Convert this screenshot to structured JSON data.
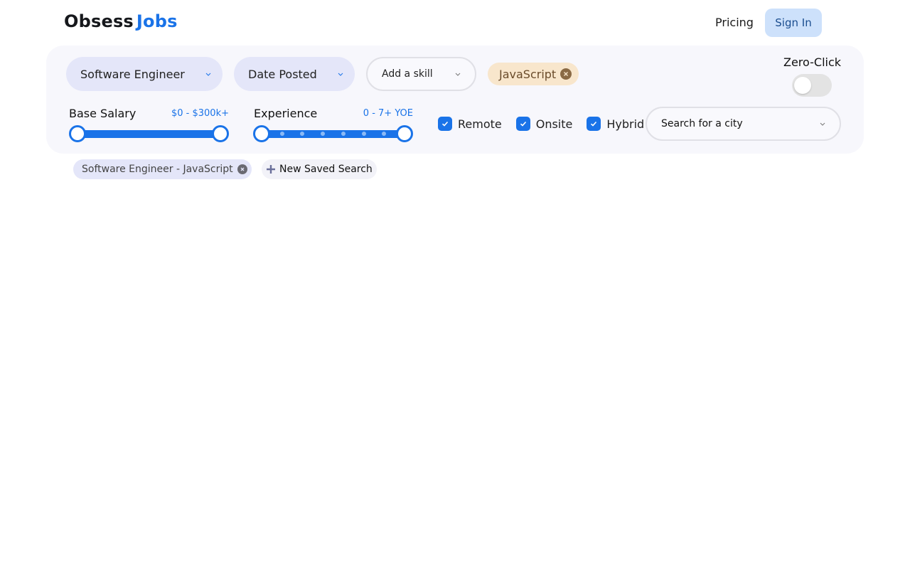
{
  "header": {
    "logo_part1": "Obsess",
    "logo_part2": "Jobs",
    "pricing_label": "Pricing",
    "signin_label": "Sign In"
  },
  "filters": {
    "role_select": {
      "value": "Software Engineer",
      "icon": "chevron-down-icon"
    },
    "date_select": {
      "value": "Date Posted",
      "icon": "chevron-down-icon"
    },
    "skill_select": {
      "placeholder": "Add a skill",
      "icon": "chevron-down-icon"
    },
    "selected_skills": [
      {
        "label": "JavaScript",
        "remove_icon": "close-circle-icon"
      }
    ],
    "zero_click": {
      "label": "Zero-Click",
      "enabled": false
    },
    "base_salary": {
      "label": "Base Salary",
      "range_text": "$0 - $300k+",
      "min": 0,
      "max": 300,
      "unit": "k",
      "selected_min": 0,
      "selected_max": 300
    },
    "experience": {
      "label": "Experience",
      "range_text": "0 - 7+ YOE",
      "min": 0,
      "max": 7,
      "selected_min": 0,
      "selected_max": 7
    },
    "work_types": [
      {
        "label": "Remote",
        "checked": true
      },
      {
        "label": "Onsite",
        "checked": true
      },
      {
        "label": "Hybrid",
        "checked": true
      }
    ],
    "city_search": {
      "placeholder": "Search for a city",
      "icon": "chevron-down-icon"
    }
  },
  "saved_searches": {
    "items": [
      {
        "label": "Software Engineer - JavaScript",
        "remove_icon": "close-circle-icon"
      }
    ],
    "new_label": "New Saved Search",
    "new_icon": "plus-icon"
  },
  "colors": {
    "accent": "#1a73e8",
    "pill_bg": "#e4e6f9",
    "skill_chip_bg": "#f8e6cc",
    "signin_bg": "#cde1fb"
  }
}
